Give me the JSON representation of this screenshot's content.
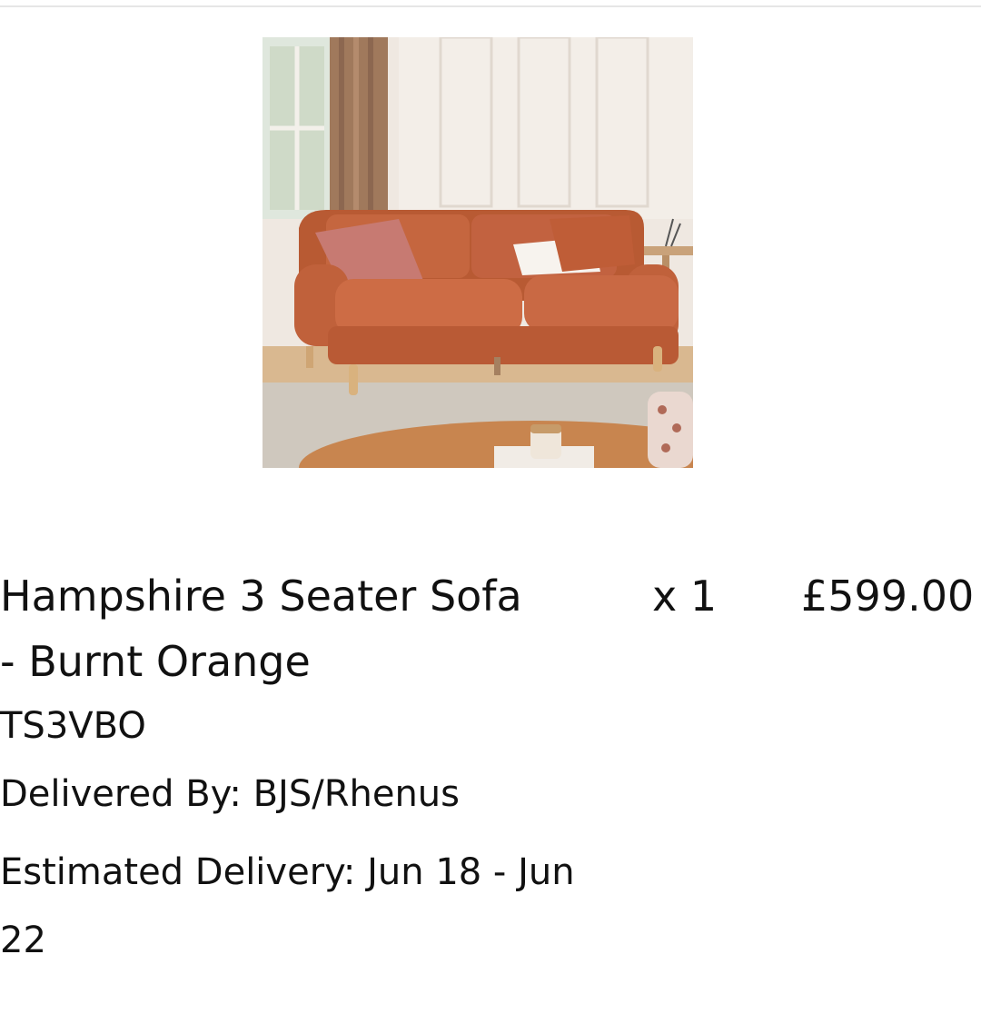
{
  "item": {
    "name": "Hampshire 3 Seater Sofa\n- Burnt Orange",
    "quantity": "x 1",
    "price": "£599.00",
    "sku": "TS3VBO",
    "delivered_by": "Delivered By: BJS/Rhenus",
    "estimated_delivery": "Estimated Delivery: Jun 18 - Jun 22",
    "image_alt": "Hampshire 3 Seater Sofa - Burnt Orange"
  },
  "colors": {
    "sofa": "#c5663f",
    "background": "#ffffff",
    "text": "#111111"
  }
}
